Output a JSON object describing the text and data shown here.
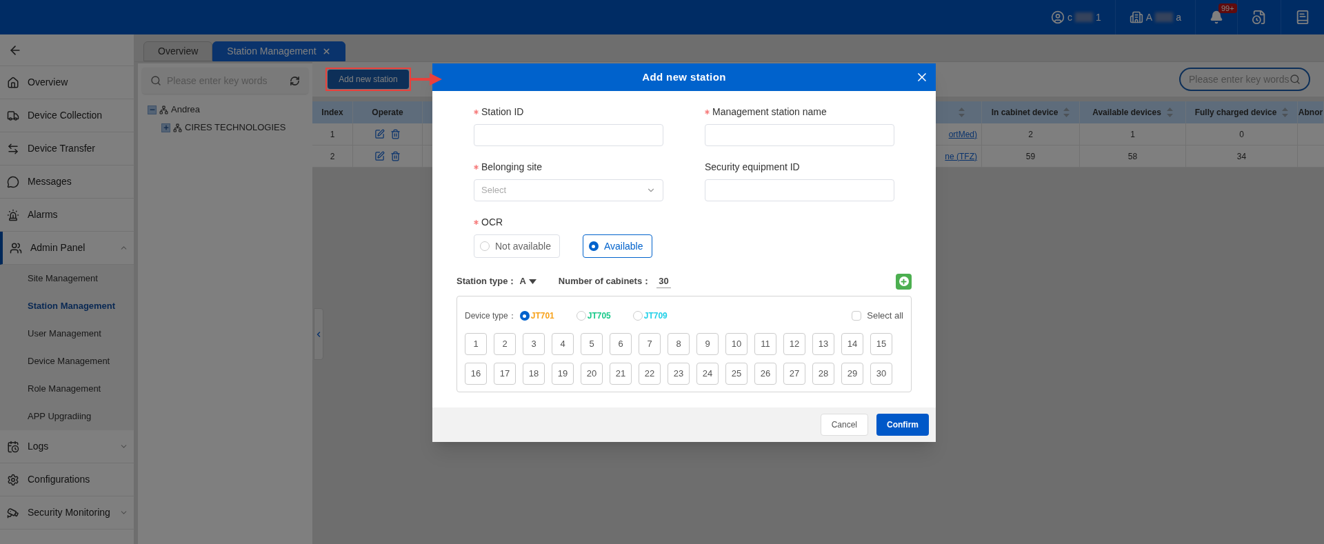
{
  "header": {
    "user": {
      "name_start": "c",
      "name_end": "1"
    },
    "org": {
      "name_start": "A",
      "name_end": "a"
    },
    "notification_badge": "99+"
  },
  "sidebar": {
    "items": [
      {
        "label": "Overview",
        "selected": false
      },
      {
        "label": "Device Collection",
        "selected": false
      },
      {
        "label": "Device Transfer",
        "selected": false
      },
      {
        "label": "Messages",
        "selected": false
      },
      {
        "label": "Alarms",
        "selected": false
      },
      {
        "label": "Admin Panel",
        "selected": true,
        "expanded": true,
        "children": [
          {
            "label": "Site Management",
            "selected": false
          },
          {
            "label": "Station Management",
            "selected": true
          },
          {
            "label": "User Management",
            "selected": false
          },
          {
            "label": "Device Management",
            "selected": false
          },
          {
            "label": "Role Management",
            "selected": false
          },
          {
            "label": "APP Upgradiing",
            "selected": false
          }
        ]
      },
      {
        "label": "Logs",
        "selected": false,
        "expanded": false
      },
      {
        "label": "Configurations",
        "selected": false
      },
      {
        "label": "Security Monitoring",
        "selected": false,
        "expanded": false
      }
    ]
  },
  "tabs": [
    {
      "label": "Overview",
      "selected": false,
      "closable": false
    },
    {
      "label": "Station Management",
      "selected": true,
      "closable": true
    }
  ],
  "tree": {
    "search": {
      "placeholder": "Please enter key words"
    },
    "nodes": [
      {
        "label": "Andrea",
        "expanded": true,
        "children": [
          {
            "label": "CIRES TECHNOLOGIES",
            "expanded": false
          }
        ]
      }
    ]
  },
  "toolbar": {
    "add_button": "Add new station",
    "search": {
      "placeholder": "Please enter key words"
    }
  },
  "table": {
    "columns": [
      {
        "label": "Index",
        "sortable": false
      },
      {
        "label": "Operate",
        "sortable": false
      },
      {
        "sortable": true
      },
      {
        "label": "In cabinet device",
        "sortable": true
      },
      {
        "label": "Available devices",
        "sortable": true
      },
      {
        "label": "Fully charged device",
        "sortable": true
      },
      {
        "label": "Abnor",
        "sortable": false
      }
    ],
    "rows": [
      {
        "index": "1",
        "column_3": "ortMed)",
        "in_cabinet": "2",
        "available": "1",
        "fully_charged": "0"
      },
      {
        "index": "2",
        "column_3": "ne (TFZ)",
        "in_cabinet": "59",
        "available": "58",
        "fully_charged": "34"
      }
    ]
  },
  "dialog": {
    "title": "Add new station",
    "fields": [
      {
        "label": "Station ID",
        "required": true,
        "kind": "input"
      },
      {
        "label": "Management station name",
        "required": true,
        "kind": "input"
      },
      {
        "label": "Belonging site",
        "required": true,
        "kind": "select",
        "placeholder": "Select"
      },
      {
        "label": "Security equipment ID",
        "required": false,
        "kind": "input"
      }
    ],
    "ocr": {
      "label": "OCR",
      "required": true,
      "options": [
        {
          "label": "Not available",
          "selected": false
        },
        {
          "label": "Available",
          "selected": true
        }
      ]
    },
    "station_type": {
      "label": "Station type：",
      "value": "A"
    },
    "cabinets": {
      "label": "Number of cabinets：",
      "value": "30"
    },
    "device_type": {
      "label": "Device type：",
      "options": [
        {
          "label": "JT701",
          "selected": true,
          "color": "#f7a21b"
        },
        {
          "label": "JT705",
          "selected": false,
          "color": "#19c98a"
        },
        {
          "label": "JT709",
          "selected": false,
          "color": "#22d0e8"
        }
      ]
    },
    "select_all": {
      "label": "Select all",
      "checked": false
    },
    "slots": [
      "1",
      "2",
      "3",
      "4",
      "5",
      "6",
      "7",
      "8",
      "9",
      "10",
      "11",
      "12",
      "13",
      "14",
      "15",
      "16",
      "17",
      "18",
      "19",
      "20",
      "21",
      "22",
      "23",
      "24",
      "25",
      "26",
      "27",
      "28",
      "29",
      "30"
    ],
    "cancel": "Cancel",
    "confirm": "Confirm"
  }
}
